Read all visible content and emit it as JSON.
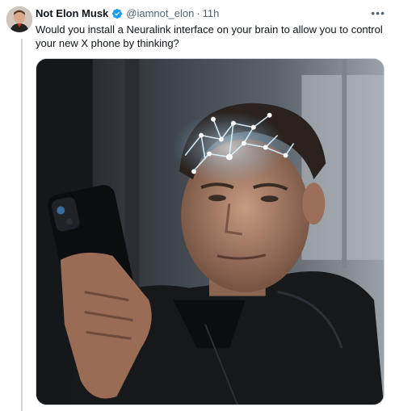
{
  "tweet": {
    "author_name": "Not Elon Musk",
    "handle": "@iamnot_elon",
    "separator": "·",
    "time": "11h",
    "more_icon": "more-horizontal-icon",
    "verified_icon": "verified-badge-icon",
    "text": "Would you install a Neuralink interface on your brain to allow you to control your new X phone by thinking?"
  },
  "colors": {
    "verified_blue": "#1d9bf0",
    "secondary_text": "#536471",
    "primary_text": "#0f1419",
    "neural_glow": "#bfe6ff"
  }
}
